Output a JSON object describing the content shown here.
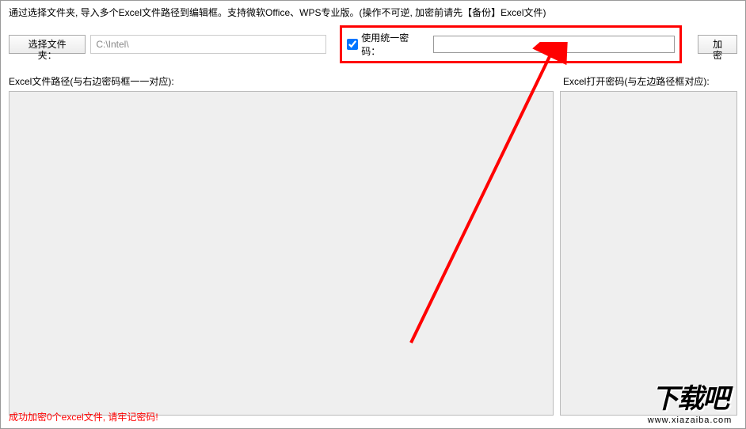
{
  "instruction": "通过选择文件夹, 导入多个Excel文件路径到编辑框。支持微软Office、WPS专业版。(操作不可逆, 加密前请先【备份】Excel文件)",
  "toolbar": {
    "select_folder_label": "选择文件夹：",
    "path_value": "C:\\Intel\\",
    "use_unified_pwd_label": "使用统一密码：",
    "pwd_value": "",
    "encrypt_label": "加密"
  },
  "labels": {
    "file_path_label": "Excel文件路径(与右边密码框一一对应):",
    "open_pwd_label": "Excel打开密码(与左边路径框对应):"
  },
  "status": "成功加密0个excel文件, 请牢记密码!",
  "watermark": {
    "text": "下载吧",
    "url": "www.xiazaiba.com"
  }
}
